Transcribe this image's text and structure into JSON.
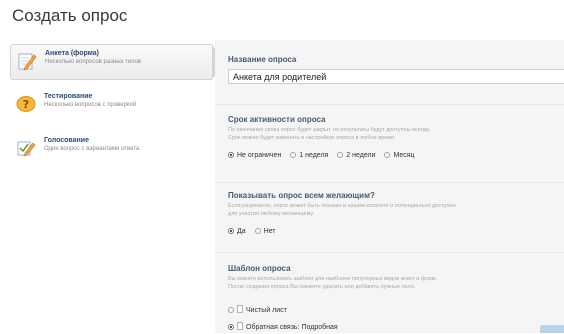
{
  "page_title": "Создать опрос",
  "types": [
    {
      "title": "Анкета (форма)",
      "desc": "Несколько вопросов разных типов",
      "icon": "form-pencil-icon",
      "active": true
    },
    {
      "title": "Тестирование",
      "desc": "Несколько вопросов с проверкой",
      "icon": "question-icon",
      "active": false
    },
    {
      "title": "Голосование",
      "desc": "Один вопрос с вариантами ответа",
      "icon": "check-pencil-icon",
      "active": false
    }
  ],
  "name_section": {
    "label": "Название опроса",
    "value": "Анкета для родителей"
  },
  "duration": {
    "label": "Срок активности опроса",
    "help": [
      "По окончании срока опрос будет закрыт, но результаты будут доступны всегда.",
      "Срок можно будет изменить в настройках опроса в любое время."
    ],
    "options": [
      "Не ограничен",
      "1 неделя",
      "2 недели",
      "Месяц"
    ],
    "selected": 0
  },
  "visibility": {
    "label": "Показывать опрос всем желающим?",
    "help": [
      "Если разрешено, опрос может быть показан в нашем каталоге и потенциально доступен",
      "для участия любому желающему."
    ],
    "options": [
      "Да",
      "Нет"
    ],
    "selected": 0
  },
  "template": {
    "label": "Шаблон опроса",
    "help": [
      "Вы можете использовать шаблон для наиболее популярных видов анкет и форм.",
      "После создания опроса Вы сможете удалить или добавить нужные поля."
    ],
    "options": [
      "Чистый лист",
      "Обратная связь: Подробная"
    ],
    "selected": 1
  }
}
